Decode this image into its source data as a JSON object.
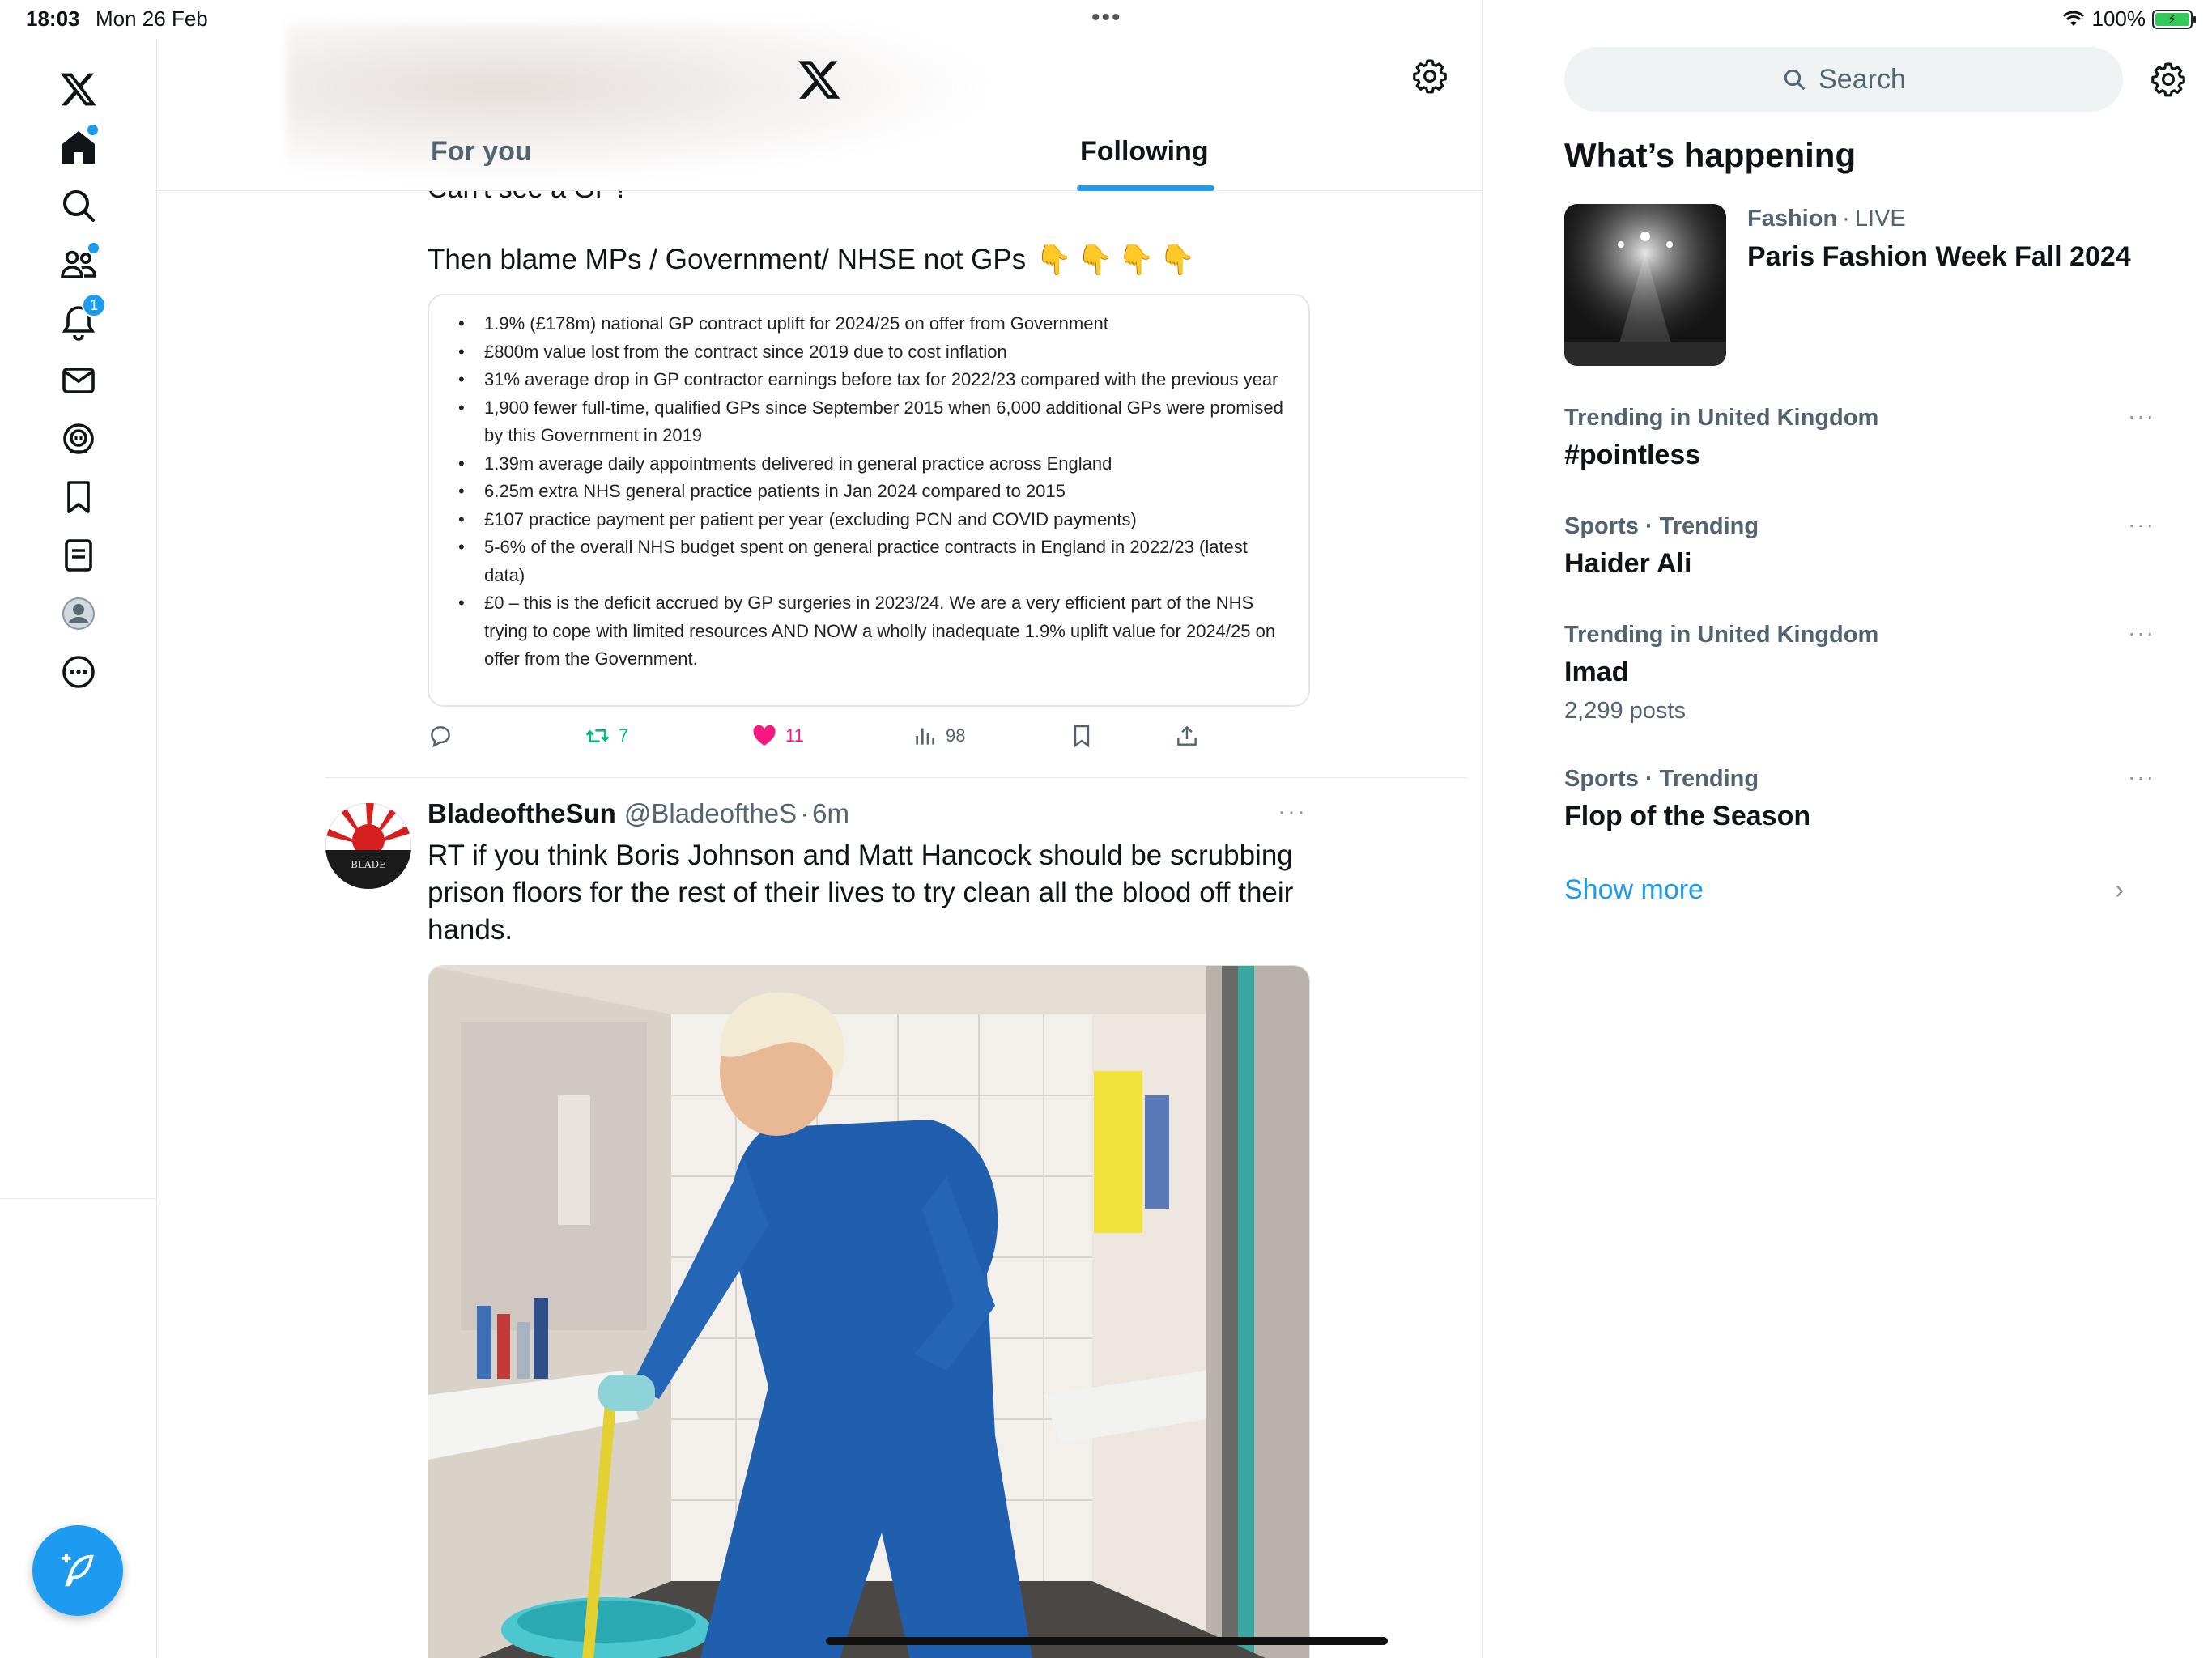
{
  "status_bar": {
    "time": "18:03",
    "date": "Mon 26 Feb",
    "battery": "100%"
  },
  "colors": {
    "accent": "#1d9bf0",
    "text_primary": "#0f1419",
    "text_secondary": "#536471",
    "like_pink": "#f91880",
    "retweet_green": "#00ba7c"
  },
  "nav": {
    "items": [
      {
        "name": "x-logo-icon"
      },
      {
        "name": "home-icon"
      },
      {
        "name": "search-icon"
      },
      {
        "name": "communities-icon"
      },
      {
        "name": "notifications-icon",
        "badge": "1"
      },
      {
        "name": "messages-icon"
      },
      {
        "name": "grok-icon"
      },
      {
        "name": "bookmarks-icon"
      },
      {
        "name": "lists-icon"
      },
      {
        "name": "profile-icon"
      },
      {
        "name": "more-icon"
      }
    ],
    "notifications_badge": "1"
  },
  "timeline": {
    "tabs": [
      {
        "label": "For you",
        "selected": false
      },
      {
        "label": "Following",
        "selected": true
      }
    ],
    "tweet1": {
      "clipped_text": "Can't see a GP?",
      "text": "Then blame MPs / Government/ NHSE not GPs",
      "emoji": "👇👇👇👇",
      "bullets": [
        "1.9% (£178m) national GP contract uplift for 2024/25 on offer from Government",
        "£800m value lost from the contract since 2019 due to cost inflation",
        "31% average drop in GP contractor earnings before tax for 2022/23 compared with the previous year",
        "1,900 fewer full-time, qualified GPs since September 2015 when 6,000 additional GPs were promised by this Government in 2019",
        "1.39m average daily appointments delivered in general practice across England",
        "6.25m extra NHS general practice patients in Jan 2024 compared to 2015",
        "£107 practice payment per patient per year (excluding PCN and COVID payments)",
        "5-6% of the overall NHS budget spent on general practice contracts in England in 2022/23 (latest data)",
        "£0 – this is the deficit accrued by GP surgeries in 2023/24. We are a very efficient part of the NHS trying to cope with limited resources AND NOW a wholly inadequate 1.9% uplift value for 2024/25 on offer from the Government."
      ],
      "retweets": "7",
      "likes": "11",
      "views": "98"
    },
    "tweet2": {
      "name": "BladeoftheSun",
      "handle": "@BladeoftheS",
      "dot": "·",
      "time": "6m",
      "more": "···",
      "text": "RT if you think Boris Johnson and Matt Hancock should be scrubbing prison floors for the rest of their lives to try clean all the blood off their hands."
    }
  },
  "sidebar": {
    "search_placeholder": "Search",
    "section_title": "What’s happening",
    "event": {
      "category": "Fashion",
      "separator": "·",
      "status": "LIVE",
      "title": "Paris Fashion Week Fall 2024"
    },
    "trends": [
      {
        "context": "Trending in United Kingdom",
        "name": "#pointless",
        "count": ""
      },
      {
        "context": "Sports · Trending",
        "name": "Haider Ali",
        "count": ""
      },
      {
        "context": "Trending in United Kingdom",
        "name": "Imad",
        "count": "2,299 posts"
      },
      {
        "context": "Sports · Trending",
        "name": "Flop of the Season",
        "count": ""
      }
    ],
    "more_glyph": "···",
    "show_more": "Show more",
    "chevron": "›"
  }
}
